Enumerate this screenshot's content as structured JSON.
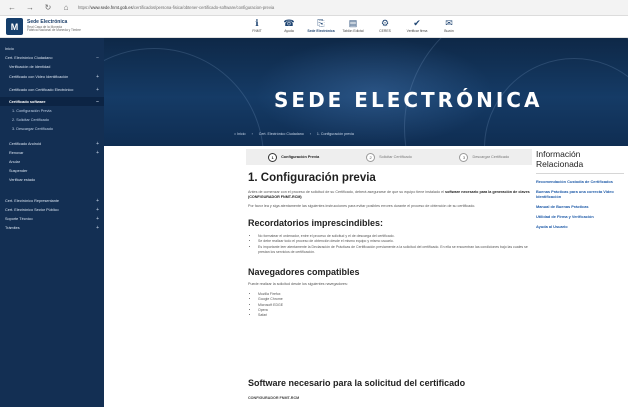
{
  "browser": {
    "back": "←",
    "forward": "→",
    "reload": "↻",
    "home": "⌂",
    "url_prefix": "https://",
    "url_host": "www.sede.fnmt.gob.es",
    "url_path": "/certificados/persona-fisica/obtener-certificado-software/configuracion-previa"
  },
  "brand": {
    "logo": "M",
    "title": "Sede Electrónica",
    "subtitle_1": "Real Casa de la Moneda",
    "subtitle_2": "Fábrica Nacional de Moneda y Timbre"
  },
  "top_menu": [
    {
      "icon": "ℹ",
      "label": "FNMT"
    },
    {
      "icon": "☎",
      "label": "Ayuda"
    },
    {
      "icon": "⎘",
      "label": "Sede Electrónica"
    },
    {
      "icon": "▤",
      "label": "Tablón Edictal"
    },
    {
      "icon": "⚙",
      "label": "CERES"
    },
    {
      "icon": "✔",
      "label": "Verificar firma"
    },
    {
      "icon": "✉",
      "label": "Buzón"
    }
  ],
  "sidebar": {
    "items": [
      {
        "label": "Inicio",
        "chev": ""
      },
      {
        "label": "Cert. Electrónico Ciudadano",
        "chev": "−"
      },
      {
        "label": "Verificación de Identidad",
        "chev": ""
      },
      {
        "label": "Certificado con Video Identificación",
        "chev": "+"
      },
      {
        "label": "Certificado con Certificado Electrónico",
        "chev": "+"
      },
      {
        "label": "Certificado software",
        "chev": "−"
      },
      {
        "label": "1. Configuración Previa",
        "chev": ""
      },
      {
        "label": "2. Solicitar Certificado",
        "chev": ""
      },
      {
        "label": "3. Descargar Certificado",
        "chev": ""
      },
      {
        "label": "Certificado Android",
        "chev": "+"
      },
      {
        "label": "Renovar",
        "chev": "+"
      },
      {
        "label": "Anular",
        "chev": ""
      },
      {
        "label": "Suspender",
        "chev": ""
      },
      {
        "label": "Verificar estado",
        "chev": ""
      },
      {
        "label": "Cert. Electrónico Representante",
        "chev": "+"
      },
      {
        "label": "Cert. Electrónico Sector Público",
        "chev": "+"
      },
      {
        "label": "Soporte Técnico",
        "chev": "+"
      },
      {
        "label": "Trámites",
        "chev": "+"
      }
    ]
  },
  "hero": {
    "title": "SEDE ELECTRÓNICA",
    "crumbs": [
      "⌂ Inicio",
      "›",
      "Cert. Electrónico Ciudadano",
      "›",
      "1. Configuración previa"
    ]
  },
  "steps": [
    {
      "num": "1",
      "label": "Configuración Previa"
    },
    {
      "num": "2",
      "label": "Solicitar Certificado"
    },
    {
      "num": "3",
      "label": "Descargar Certificado"
    }
  ],
  "main": {
    "title": "1. Configuración previa",
    "intro_1": "Antes de comenzar con el proceso de solicitud de su Certificado, deberá asegurarse de que su equipo tiene instalado el",
    "intro_bold": "software necesario para la generación de claves (CONFIGURADOR FNMT-RCM)",
    "intro_2": "Por favor lea y siga atentamente las siguientes instrucciones para evitar posibles errores durante el proceso de obtención de su certificado.",
    "reminders_title": "Recordatorios imprescindibles:",
    "reminders": [
      "No formatear el ordenador, entre el proceso de solicitud y el de descarga del certificado.",
      "Se debe realizar todo el proceso de obtención desde el mismo equipo y mismo usuario.",
      "Es importante leer atentamente la Declaración de Prácticas de Certificación previamente a la solicitud del certificado. En ella se encuentran las condiciones bajo las cuales se prestan los servicios de certificación."
    ],
    "browsers_title": "Navegadores compatibles",
    "browsers_intro": "Puede realizar la solicitud desde los siguientes navegadores:",
    "browsers": [
      "Mozilla Firefox",
      "Google Chrome",
      "Microsoft EDGE",
      "Opera",
      "Safari"
    ],
    "software_title": "Software necesario para la solicitud del certificado",
    "software_sub": "CONFIGURADOR FNMT-RCM"
  },
  "related": {
    "title": "Información Relacionada",
    "links": [
      "Recomendación Custodia de Certificados",
      "Buenas Prácticas para una correcta Video Identificación",
      "Manual de Buenas Prácticas",
      "Utilidad de Firma y Verificación",
      "Ayuda al Usuario"
    ]
  },
  "colors": {
    "sidebar": "#132f53",
    "hero": "#153b66",
    "link": "#1f5ba8"
  }
}
